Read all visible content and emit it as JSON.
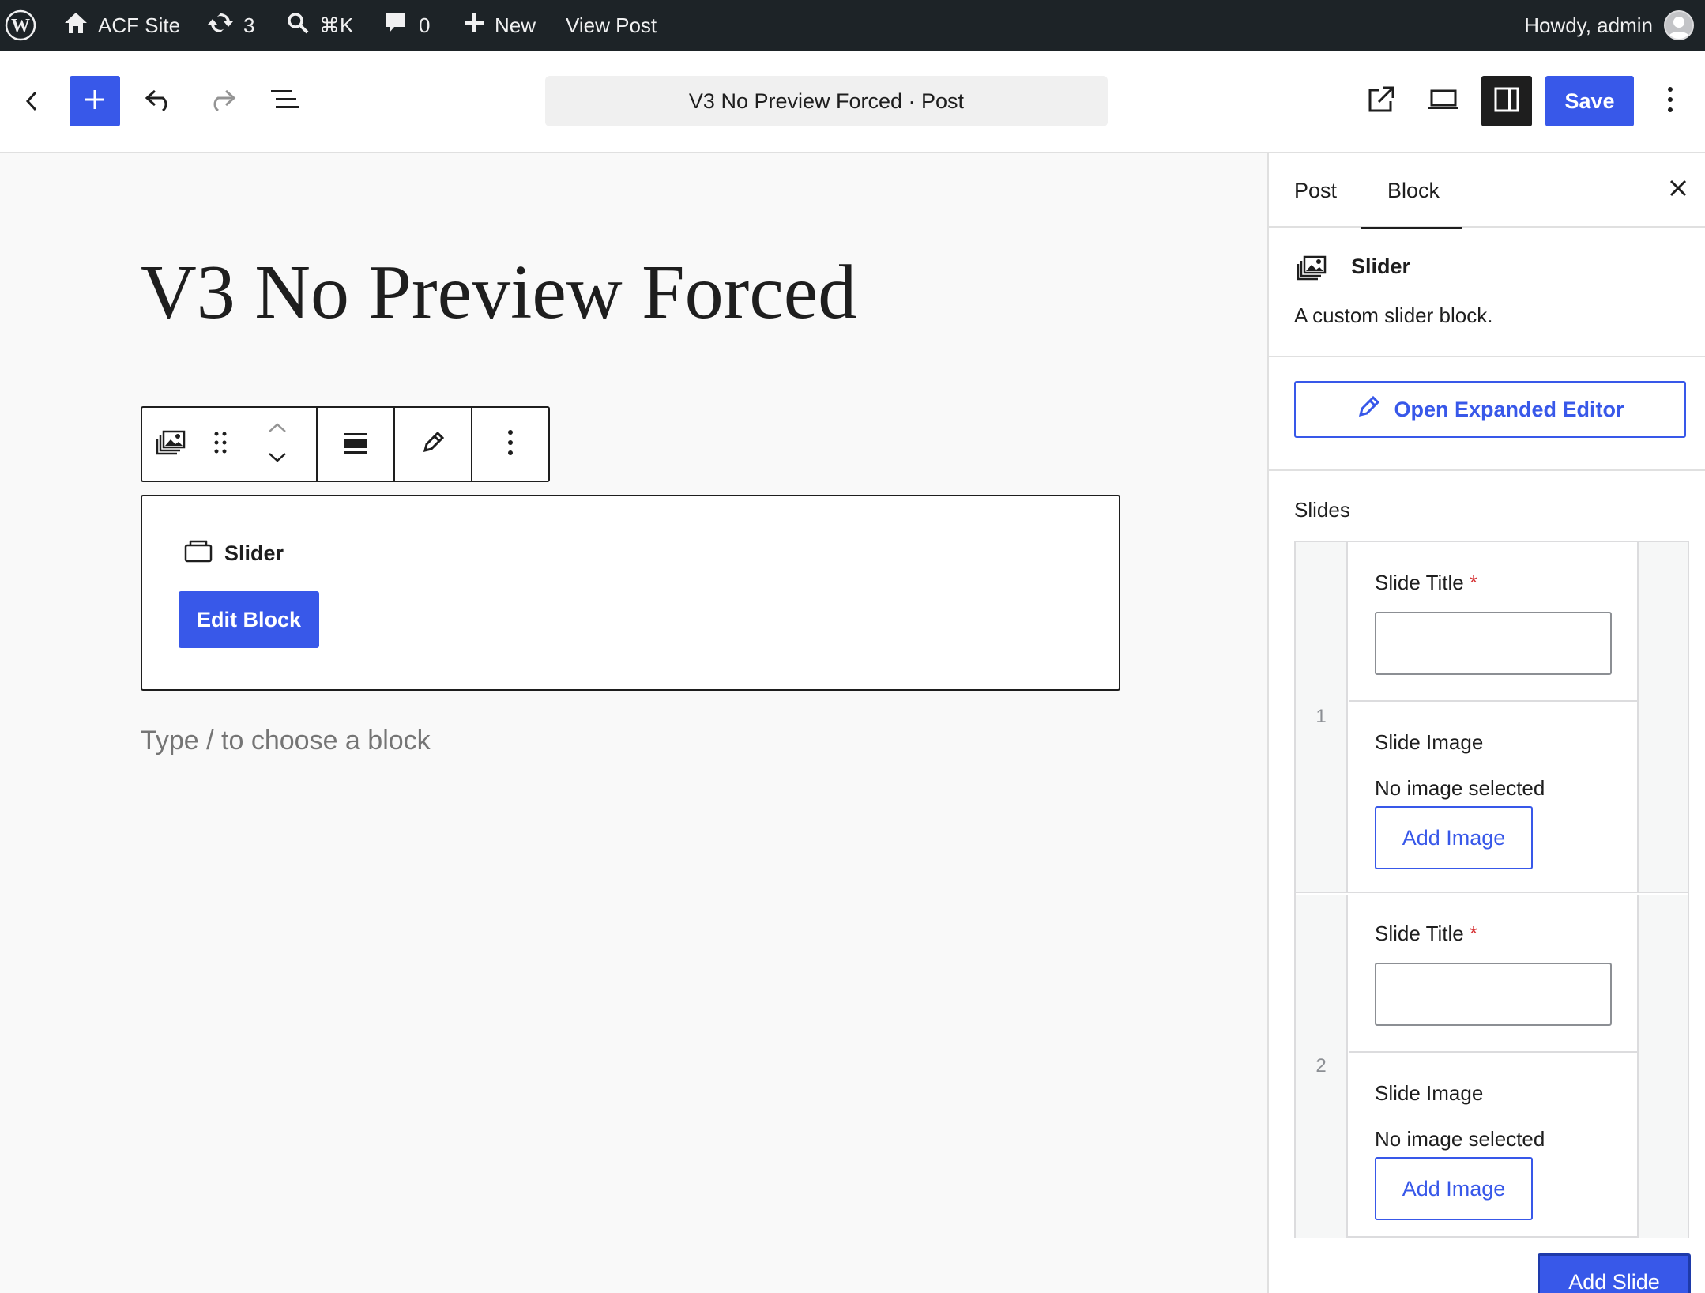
{
  "admin_bar": {
    "site_name": "ACF Site",
    "updates_count": "3",
    "search_shortcut": "⌘K",
    "comments_count": "0",
    "new_label": "New",
    "view_post_label": "View Post",
    "greeting": "Howdy, admin"
  },
  "header": {
    "document_title": "V3 No Preview Forced · Post",
    "save_label": "Save"
  },
  "canvas": {
    "post_title": "V3 No Preview Forced",
    "block_label": "Slider",
    "edit_block_label": "Edit Block",
    "appender_placeholder": "Type / to choose a block"
  },
  "sidebar": {
    "tabs": [
      {
        "label": "Post"
      },
      {
        "label": "Block",
        "active": true
      }
    ],
    "block_card": {
      "title": "Slider",
      "description": "A custom slider block."
    },
    "open_expanded_editor_label": "Open Expanded Editor",
    "slides_label": "Slides",
    "rows": [
      {
        "index": "1",
        "title_label": "Slide Title",
        "required_mark": "*",
        "title_value": "",
        "image_label": "Slide Image",
        "no_image_text": "No image selected",
        "add_image_label": "Add Image"
      },
      {
        "index": "2",
        "title_label": "Slide Title",
        "required_mark": "*",
        "title_value": "",
        "image_label": "Slide Image",
        "no_image_text": "No image selected",
        "add_image_label": "Add Image"
      }
    ],
    "add_slide_label": "Add Slide"
  },
  "colors": {
    "accent": "#3858e9",
    "admin_bar_bg": "#1d2327",
    "required": "#d63638"
  }
}
